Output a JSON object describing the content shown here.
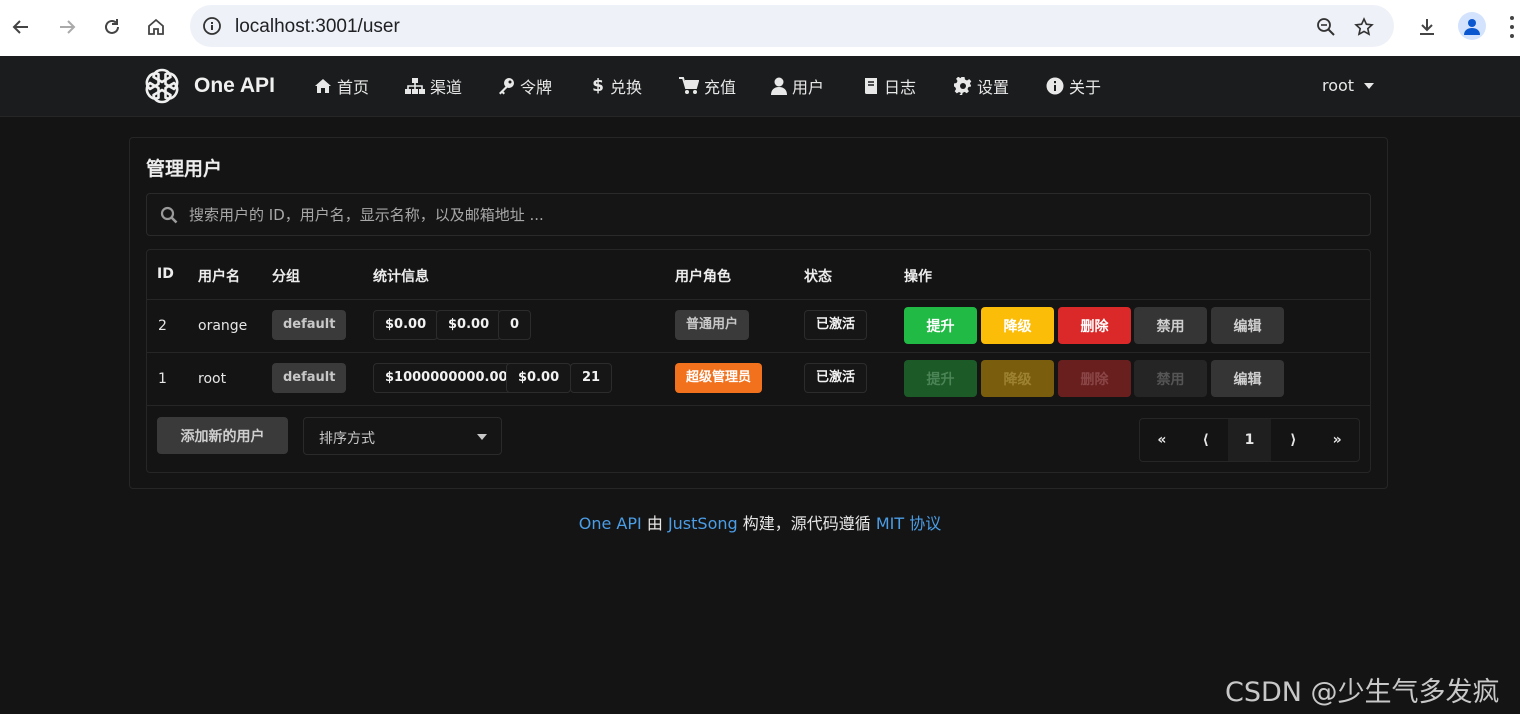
{
  "browser": {
    "url": "localhost:3001/user"
  },
  "app": {
    "brand_name": "One API",
    "nav": [
      {
        "label": "首页",
        "icon": "home-icon"
      },
      {
        "label": "渠道",
        "icon": "sitemap-icon"
      },
      {
        "label": "令牌",
        "icon": "key-icon"
      },
      {
        "label": "兑换",
        "icon": "dollar-icon"
      },
      {
        "label": "充值",
        "icon": "cart-icon"
      },
      {
        "label": "用户",
        "icon": "user-icon"
      },
      {
        "label": "日志",
        "icon": "book-icon"
      },
      {
        "label": "设置",
        "icon": "gear-icon"
      },
      {
        "label": "关于",
        "icon": "info-icon"
      }
    ],
    "user_menu_label": "root"
  },
  "page": {
    "title": "管理用户",
    "search_placeholder": "搜索用户的 ID，用户名，显示名称，以及邮箱地址 ..."
  },
  "table": {
    "headers": {
      "id": "ID",
      "username": "用户名",
      "group": "分组",
      "stats": "统计信息",
      "role": "用户角色",
      "status": "状态",
      "actions": "操作"
    },
    "rows": [
      {
        "id": "2",
        "username": "orange",
        "group": "default",
        "stat1": "$0.00",
        "stat2": "$0.00",
        "stat3": "0",
        "role": "普通用户",
        "status": "已激活",
        "btn_promote": "提升",
        "btn_demote": "降级",
        "btn_delete": "删除",
        "btn_disable": "禁用",
        "btn_edit": "编辑"
      },
      {
        "id": "1",
        "username": "root",
        "group": "default",
        "stat1": "$1000000000.00",
        "stat2": "$0.00",
        "stat3": "21",
        "role": "超级管理员",
        "status": "已激活",
        "btn_promote": "提升",
        "btn_demote": "降级",
        "btn_delete": "删除",
        "btn_disable": "禁用",
        "btn_edit": "编辑"
      }
    ],
    "add_button": "添加新的用户",
    "sort_placeholder": "排序方式",
    "pagination": {
      "first": "«",
      "prev": "⟨",
      "current": "1",
      "next": "⟩",
      "last": "»"
    }
  },
  "footer": {
    "link1": "One API",
    "text1": " 由 ",
    "link2": "JustSong",
    "text2": " 构建，源代码遵循 ",
    "link3": "MIT 协议"
  },
  "watermark": "CSDN @少生气多发疯",
  "colors": {
    "primary_link": "#4b9de6",
    "green": "#21ba45",
    "yellow": "#fbbd08",
    "red": "#db2828",
    "orange": "#f2711c"
  }
}
